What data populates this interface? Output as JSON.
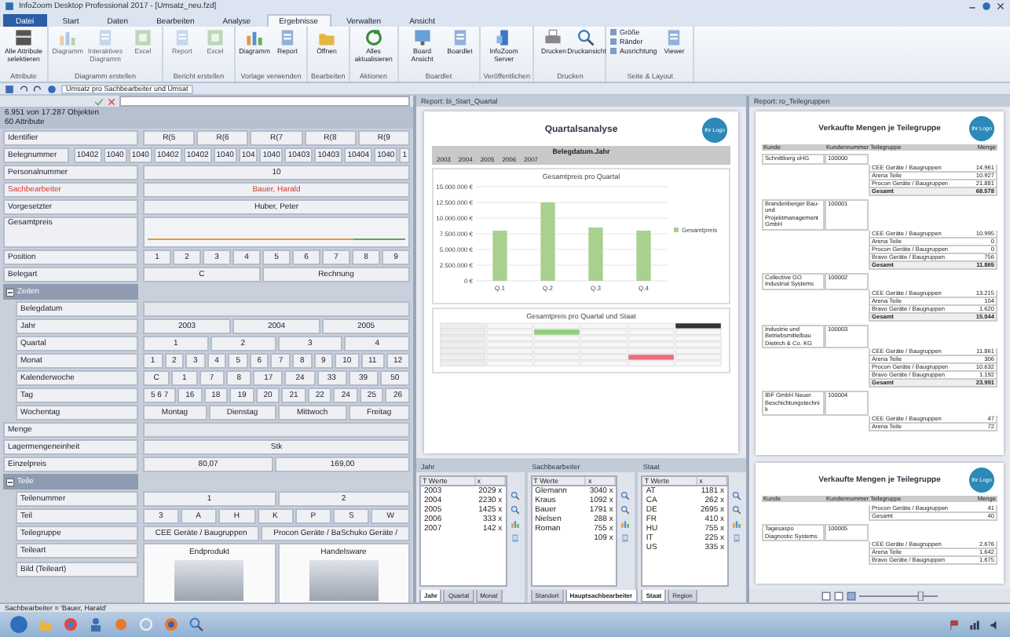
{
  "window": {
    "title": "InfoZoom Desktop Professional 2017 - [Umsatz_neu.fzd]"
  },
  "ribbon_tabs": [
    {
      "label": "Datei",
      "kind": "file",
      "selected": false
    },
    {
      "label": "Start",
      "kind": "tab",
      "selected": false
    },
    {
      "label": "Daten",
      "kind": "tab",
      "selected": false
    },
    {
      "label": "Bearbeiten",
      "kind": "tab",
      "selected": false
    },
    {
      "label": "Analyse",
      "kind": "tab",
      "selected": false
    },
    {
      "label": "Ergebnisse",
      "kind": "tab",
      "selected": true
    },
    {
      "label": "Verwalten",
      "kind": "tab",
      "selected": false
    },
    {
      "label": "Ansicht",
      "kind": "tab",
      "selected": false
    }
  ],
  "ribbon_groups": [
    {
      "label": "Attribute",
      "buttons": [
        {
          "label": "Alle Attribute selektieren",
          "kind": "large",
          "disabled": false
        }
      ]
    },
    {
      "label": "Diagramm erstellen",
      "buttons": [
        {
          "label": "Diagramm",
          "kind": "large",
          "disabled": true
        },
        {
          "label": "Interaktives Diagramm",
          "kind": "large",
          "disabled": true
        },
        {
          "label": "Excel",
          "kind": "large",
          "disabled": true
        }
      ]
    },
    {
      "label": "Bericht erstellen",
      "buttons": [
        {
          "label": "Report",
          "kind": "large",
          "disabled": true
        },
        {
          "label": "Excel",
          "kind": "large",
          "disabled": true
        }
      ]
    },
    {
      "label": "Vorlage verwenden",
      "buttons": [
        {
          "label": "Diagramm",
          "kind": "large",
          "disabled": false
        },
        {
          "label": "Report",
          "kind": "large",
          "disabled": false
        }
      ]
    },
    {
      "label": "Bearbeiten",
      "buttons": [
        {
          "label": "Öffnen",
          "kind": "large",
          "disabled": false
        }
      ]
    },
    {
      "label": "Aktionen",
      "buttons": [
        {
          "label": "Alles aktualisieren",
          "kind": "large",
          "disabled": false
        }
      ]
    },
    {
      "label": "Boardlet",
      "buttons": [
        {
          "label": "Board Ansicht",
          "kind": "large",
          "disabled": false
        },
        {
          "label": "Boardlet",
          "kind": "large",
          "disabled": false
        }
      ]
    },
    {
      "label": "Veröffentlichen",
      "buttons": [
        {
          "label": "InfoZoom Server",
          "kind": "large",
          "disabled": false
        }
      ]
    },
    {
      "label": "Drucken",
      "buttons": [
        {
          "label": "Drucken",
          "kind": "large",
          "disabled": false
        },
        {
          "label": "Druckansicht",
          "kind": "large",
          "disabled": false
        }
      ]
    },
    {
      "label": "Seite & Layout",
      "buttons": [
        {
          "label": "Größe",
          "kind": "small",
          "disabled": false
        },
        {
          "label": "Ränder",
          "kind": "small",
          "disabled": false
        },
        {
          "label": "Ausrichtung",
          "kind": "small",
          "disabled": false
        },
        {
          "label": "Viewer",
          "kind": "large",
          "disabled": false
        }
      ]
    }
  ],
  "quick_access": {
    "selector": "Umsatz pro Sachbearbeiter und Umsat"
  },
  "attribute_panel": {
    "object_count": "6.951 von 17.287 Objekten",
    "attribute_count": "60 Attribute",
    "rows": [
      {
        "label": "Identifier",
        "kind": "values",
        "highlighted": false,
        "cells": [
          "R(5",
          "R(6",
          "R(7",
          "R(8",
          "R(9"
        ]
      },
      {
        "label": "Belegnummer",
        "kind": "values",
        "highlighted": false,
        "cells": [
          "10402",
          "1040",
          "1040",
          "10402",
          "10402",
          "1040",
          "104",
          "1040",
          "10403",
          "10403",
          "10404",
          "1040",
          "1"
        ]
      },
      {
        "label": "Personalnummer",
        "kind": "values",
        "highlighted": false,
        "cells": [
          "10"
        ]
      },
      {
        "label": "Sachbearbeiter",
        "kind": "values",
        "highlighted": true,
        "cells": [
          "Bauer, Harald"
        ]
      },
      {
        "label": "Vorgesetzter",
        "kind": "values",
        "highlighted": false,
        "cells": [
          "Huber, Peter"
        ]
      },
      {
        "label": "Gesamtpreis",
        "kind": "graph",
        "highlighted": false
      },
      {
        "label": "Position",
        "kind": "values",
        "highlighted": false,
        "cells": [
          "1",
          "2",
          "3",
          "4",
          "5",
          "6",
          "7",
          "8",
          "9"
        ]
      },
      {
        "label": "Belegart",
        "kind": "values",
        "highlighted": false,
        "cells": [
          "C",
          "Rechnung"
        ]
      },
      {
        "label": "Zeiten",
        "kind": "group",
        "expanded": true,
        "children": [
          {
            "label": "Belegdatum",
            "kind": "values",
            "highlighted": false
          },
          {
            "label": "Jahr",
            "kind": "values",
            "highlighted": false,
            "cells": [
              "2003",
              "2004",
              "2005"
            ]
          },
          {
            "label": "Quartal",
            "kind": "values",
            "highlighted": false,
            "cells": [
              "1",
              "2",
              "3",
              "4"
            ]
          },
          {
            "label": "Monat",
            "kind": "values",
            "highlighted": false,
            "cells": [
              "1",
              "2",
              "3",
              "4",
              "5",
              "6",
              "7",
              "8",
              "9",
              "10",
              "11",
              "12"
            ]
          },
          {
            "label": "Kalenderwoche",
            "kind": "values",
            "highlighted": false,
            "cells": [
              "C",
              "1",
              "7",
              "8",
              "17",
              "24",
              "33",
              "39",
              "50"
            ]
          },
          {
            "label": "Tag",
            "kind": "values",
            "highlighted": false,
            "cells": [
              "5 6 7",
              "16",
              "18",
              "19",
              "20",
              "21",
              "22",
              "24",
              "25",
              "26"
            ]
          },
          {
            "label": "Wochentag",
            "kind": "values",
            "highlighted": false,
            "cells": [
              "Montag",
              "Dienstag",
              "Mittwoch",
              "Freitag"
            ]
          }
        ]
      },
      {
        "label": "Menge",
        "kind": "values",
        "highlighted": false
      },
      {
        "label": "Lagermengeneinheit",
        "kind": "values",
        "highlighted": false,
        "cells": [
          "Stk"
        ]
      },
      {
        "label": "Einzelpreis",
        "kind": "values",
        "highlighted": false,
        "cells": [
          "80,07",
          "169,00"
        ]
      },
      {
        "label": "Teile",
        "kind": "group",
        "expanded": true,
        "children": [
          {
            "label": "Teilenummer",
            "kind": "values",
            "highlighted": false,
            "cells": [
              "1",
              "2"
            ]
          },
          {
            "label": "Teil",
            "kind": "values",
            "highlighted": false,
            "cells": [
              "3",
              "A",
              "H",
              "K",
              "P",
              "S",
              "W"
            ]
          },
          {
            "label": "Teilegruppe",
            "kind": "values",
            "highlighted": false,
            "cells": [
              "CEE Geräte / Baugruppen",
              "Procon Geräte / BaSchuko Geräte /"
            ]
          },
          {
            "label": "Teileart",
            "second_label": "Bild (Teileart)",
            "kind": "images",
            "highlighted": false,
            "cells": [
              "Endprodukt",
              "Handelsware"
            ]
          }
        ]
      }
    ]
  },
  "report_left": {
    "title": "Report: bi_Start_Quartal",
    "heading": "Quartalsanalyse",
    "logo": "Ihr Logo",
    "filter_header": "Belegdatum.Jahr",
    "filter_values": [
      "2003",
      "2004",
      "2005",
      "2006",
      "2007"
    ],
    "chart_data": {
      "type": "bar",
      "title": "Gesamtpreis pro Quartal",
      "categories": [
        "Q.1",
        "Q.2",
        "Q.3",
        "Q.4"
      ],
      "series": [
        {
          "name": "Gesamtpreis",
          "color": "#a9d08e",
          "values": [
            8000000,
            12500000,
            8500000,
            8000000
          ]
        }
      ],
      "ylim": [
        0,
        15000000
      ],
      "grid": true,
      "yticks": [
        {
          "value": 0,
          "label": "0 €"
        },
        {
          "value": 2500000,
          "label": "2.500.000 €"
        },
        {
          "value": 5000000,
          "label": "5.000.000 €"
        },
        {
          "value": 7500000,
          "label": "7.500.000 €"
        },
        {
          "value": 10000000,
          "label": "10.000.000 €"
        },
        {
          "value": 12500000,
          "label": "12.500.000 €"
        },
        {
          "value": 15000000,
          "label": "15.000.000 €"
        }
      ]
    },
    "table_title": "Gesamtpreis pro Quartal und Staat"
  },
  "panes": [
    {
      "title": "Jahr",
      "columns": [
        "T Werte",
        "x"
      ],
      "items": [
        {
          "label": "2003",
          "count": "2029 x"
        },
        {
          "label": "2004",
          "count": "2230 x"
        },
        {
          "label": "2005",
          "count": "1425 x"
        },
        {
          "label": "2006",
          "count": "333 x"
        },
        {
          "label": "2007",
          "count": "142 x"
        }
      ],
      "tabs": [
        {
          "label": "Jahr",
          "selected": true
        },
        {
          "label": "Quartal",
          "selected": false
        },
        {
          "label": "Monat",
          "selected": false
        }
      ]
    },
    {
      "title": "Sachbearbeiter",
      "columns": [
        "T Werte",
        "x"
      ],
      "items": [
        {
          "label": "Glemann",
          "count": "3040 x"
        },
        {
          "label": "Kraus",
          "count": "1092 x"
        },
        {
          "label": "Bauer",
          "count": "1791 x"
        },
        {
          "label": "Nielsen",
          "count": "288 x"
        },
        {
          "label": "Roman",
          "count": "755 x"
        },
        {
          "count": "109 x"
        }
      ],
      "tabs": [
        {
          "label": "Standort",
          "selected": false
        },
        {
          "label": "Hauptsachbearbeiter",
          "selected": true
        }
      ]
    },
    {
      "title": "Staat",
      "columns": [
        "T Werte",
        "x"
      ],
      "items": [
        {
          "label": "AT",
          "count": "1181 x"
        },
        {
          "label": "CA",
          "count": "262 x"
        },
        {
          "label": "DE",
          "count": "2695 x"
        },
        {
          "label": "FR",
          "count": "410 x"
        },
        {
          "label": "HU",
          "count": "755 x"
        },
        {
          "label": "IT",
          "count": "225 x"
        },
        {
          "label": "US",
          "count": "335 x"
        }
      ],
      "tabs": [
        {
          "label": "Staat",
          "selected": true
        },
        {
          "label": "Region",
          "selected": false
        }
      ]
    }
  ],
  "report_right": {
    "title": "Report: ro_Teilegruppen",
    "pages": [
      {
        "heading": "Verkaufte Mengen je Teilegruppe",
        "logo": "Ihr Logo",
        "columns": [
          "Kunde",
          "Kundennummer",
          "Teilegruppe",
          "Menge"
        ],
        "customers": [
          {
            "name": "Schnittberg oHG",
            "number": "100000",
            "groups": [
              {
                "name": "CEE Geräte / Baugruppen",
                "value": "14.961"
              },
              {
                "name": "Arena Teile",
                "value": "10.927"
              },
              {
                "name": "Procon Geräte / Baugruppen",
                "value": "21.881"
              },
              {
                "name": "Gesamt",
                "value": "68.578"
              }
            ]
          },
          {
            "name": "Brandenberger Bau- und Projektmanagement GmbH",
            "number": "100001",
            "groups": [
              {
                "name": "CEE Geräte / Baugruppen",
                "value": "10.995"
              },
              {
                "name": "Arena Teile",
                "value": "0"
              },
              {
                "name": "Procon Geräte / Baugruppen",
                "value": "0"
              },
              {
                "name": "Bravo Geräte / Baugruppen",
                "value": "756"
              },
              {
                "name": "Gesamt",
                "value": "11.865"
              }
            ]
          },
          {
            "name": "Collective GO Industrial Systems",
            "number": "100002",
            "groups": [
              {
                "name": "CEE Geräte / Baugruppen",
                "value": "13.215"
              },
              {
                "name": "Arena Teile",
                "value": "104"
              },
              {
                "name": "Bravo Geräte / Baugruppen",
                "value": "1.620"
              },
              {
                "name": "Gesamt",
                "value": "15.044"
              }
            ]
          },
          {
            "name": "Industrie und Betriebsmittelbau Dietrich & Co. KG",
            "number": "100003",
            "groups": [
              {
                "name": "CEE Geräte / Baugruppen",
                "value": "11.861"
              },
              {
                "name": "Arena Teile",
                "value": "306"
              },
              {
                "name": "Procon Geräte / Baugruppen",
                "value": "10.632"
              },
              {
                "name": "Bravo Geräte / Baugruppen",
                "value": "1.192"
              },
              {
                "name": "Gesamt",
                "value": "23.991"
              }
            ]
          },
          {
            "name": "IBF GmbH Neuer Beschichtungstechnik",
            "number": "100004",
            "groups": [
              {
                "name": "CEE Geräte / Baugruppen",
                "value": "47"
              },
              {
                "name": "Arena Teile",
                "value": "72"
              }
            ]
          }
        ]
      },
      {
        "heading": "Verkaufte Mengen je Teilegruppe",
        "logo": "Ihr Logo",
        "columns": [
          "Kunde",
          "Kundennummer",
          "Teilegruppe",
          "Menge"
        ],
        "customers": [
          {
            "groups": [
              {
                "name": "Procon Geräte / Baugruppen",
                "value": "41"
              },
              {
                "name": "Gesamt",
                "value": "40"
              }
            ]
          },
          {
            "name": "Tagesaspo Diagnostic Systems",
            "number": "100005",
            "groups": [
              {
                "name": "CEE Geräte / Baugruppen",
                "value": "2.676"
              },
              {
                "name": "Arena Teile",
                "value": "1.642"
              },
              {
                "name": "Bravo Geräte / Baugruppen",
                "value": "1.675"
              }
            ]
          }
        ]
      }
    ]
  },
  "zoom": {
    "level": 0.8
  },
  "status_bar": {
    "text": "Sachbearbeiter = 'Bauer, Harald'"
  }
}
